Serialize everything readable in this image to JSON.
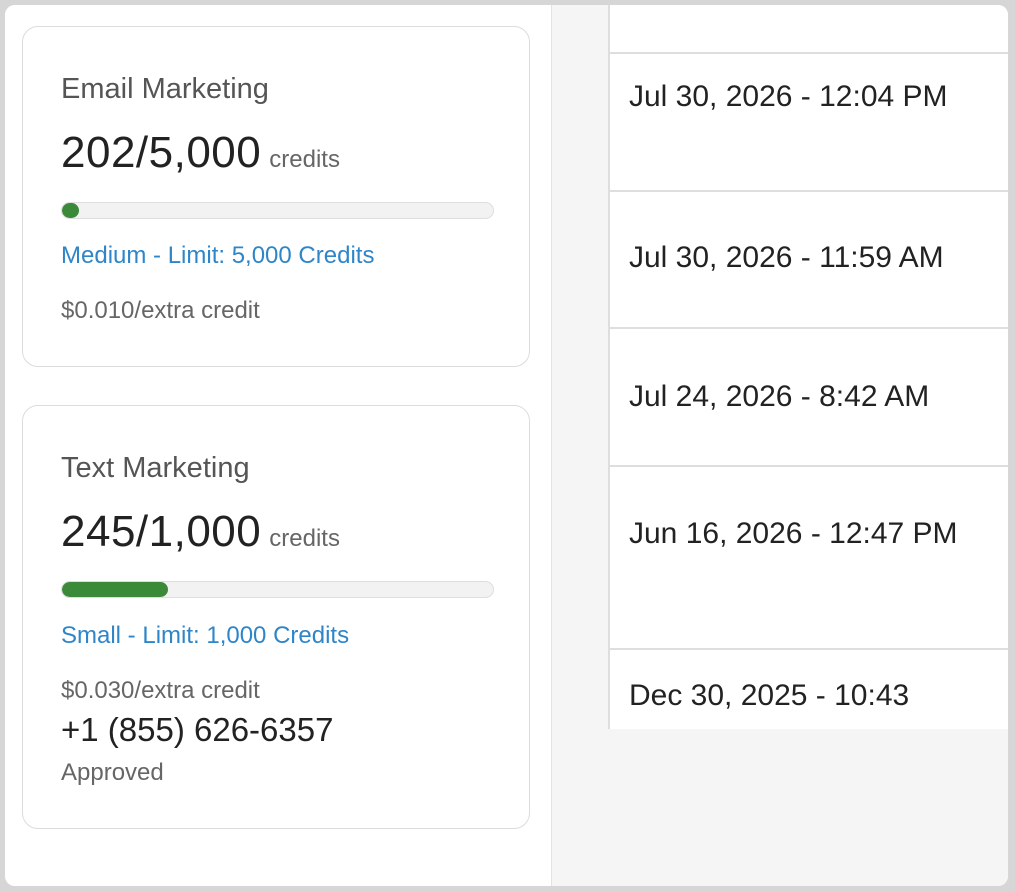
{
  "email_card": {
    "title": "Email Marketing",
    "usage": "202/5,000",
    "unit": "credits",
    "progress_fraction": 0.0404,
    "plan": "Medium - Limit: 5,000 Credits",
    "extra_rate": "$0.010/extra credit"
  },
  "text_card": {
    "title": "Text Marketing",
    "usage": "245/1,000",
    "unit": "credits",
    "progress_fraction": 0.245,
    "plan": "Small - Limit: 1,000 Credits",
    "extra_rate": "$0.030/extra credit",
    "phone": "+1 (855) 626-6357",
    "status": "Approved"
  },
  "dates": [
    "",
    "Jul 30, 2026 - 12:04 PM",
    "Jul 30, 2026 - 11:59 AM",
    "Jul 24, 2026 - 8:42 AM",
    "Jun 16, 2026 - 12:47 PM",
    "Dec 30, 2025 - 10:43"
  ],
  "colors": {
    "accent_link": "#2e86c9",
    "progress_fill": "#3a8a3a"
  }
}
